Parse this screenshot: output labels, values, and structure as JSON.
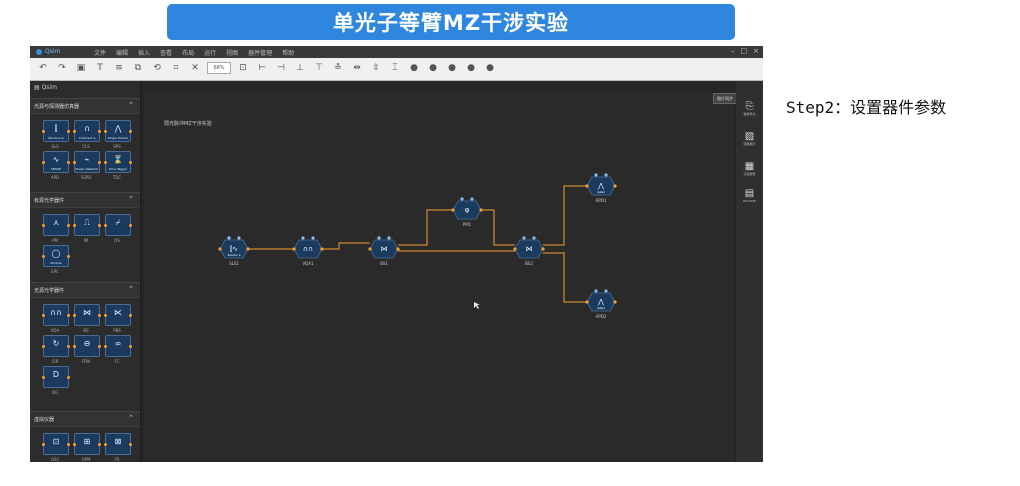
{
  "banner": {
    "title": "单光子等臂MZ干涉实验"
  },
  "step": {
    "label": "Step2：设置器件参数"
  },
  "app": {
    "name": "Qsim",
    "menu": [
      "文件",
      "编辑",
      "插入",
      "查看",
      "布局",
      "运行",
      "视图",
      "器件管理",
      "帮助"
    ],
    "zoom": "68%",
    "sidebar_title": "Qsim",
    "sections": [
      {
        "title": "光源与探测器仿真器",
        "items": [
          {
            "label": "SLS",
            "cap": "Random φ"
          },
          {
            "label": "CLS",
            "cap": "Coherent φ"
          },
          {
            "label": "SPS",
            "cap": "Single Photon"
          },
          {
            "label": "APD",
            "cap": "SNSPD"
          },
          {
            "label": "SSPD",
            "cap": "Power Detector"
          },
          {
            "label": "TDC",
            "cap": "Time Tagger"
          }
        ]
      },
      {
        "title": "有源光学器件",
        "items": [
          {
            "label": "PM",
            "cap": ""
          },
          {
            "label": "IM",
            "cap": ""
          },
          {
            "label": "OS",
            "cap": ""
          },
          {
            "label": "EPC",
            "cap": "Module"
          }
        ]
      },
      {
        "title": "无源光学器件",
        "items": [
          {
            "label": "VOA",
            "cap": ""
          },
          {
            "label": "BS",
            "cap": ""
          },
          {
            "label": "PBS",
            "cap": ""
          },
          {
            "label": "CIR",
            "cap": ""
          },
          {
            "label": "FRM",
            "cap": ""
          },
          {
            "label": "FC",
            "cap": ""
          },
          {
            "label": "DG",
            "cap": ""
          }
        ]
      },
      {
        "title": "虚拟仪器",
        "items": [
          {
            "label": "OSC",
            "cap": ""
          },
          {
            "label": "OPM",
            "cap": ""
          },
          {
            "label": "FR",
            "cap": ""
          }
        ]
      }
    ],
    "canvas_title": "弱光脉冲MZ干涉实验",
    "sync_label": "图片同步",
    "right_panel": [
      {
        "icon": "export-icon",
        "label": "数据导出"
      },
      {
        "icon": "chart-icon",
        "label": "结果展示"
      },
      {
        "icon": "calendar-icon",
        "label": "实验报告"
      },
      {
        "icon": "notes-icon",
        "label": "README"
      }
    ],
    "nodes": [
      {
        "id": "SLS1",
        "label": "SLS1",
        "cap": "Random φ"
      },
      {
        "id": "VOA1",
        "label": "VOA1",
        "cap": ""
      },
      {
        "id": "BS1",
        "label": "BS1",
        "cap": ""
      },
      {
        "id": "PM1",
        "label": "PM1",
        "cap": ""
      },
      {
        "id": "BS2",
        "label": "BS2",
        "cap": ""
      },
      {
        "id": "APD1",
        "label": "APD1",
        "cap": "Gated"
      },
      {
        "id": "APD2",
        "label": "APD2",
        "cap": "Gated"
      }
    ],
    "colors": {
      "link": "#f0a030",
      "node_fill": "#1b3b5e",
      "node_border": "#4a6e93",
      "canvas": "#2a2a2a"
    }
  }
}
